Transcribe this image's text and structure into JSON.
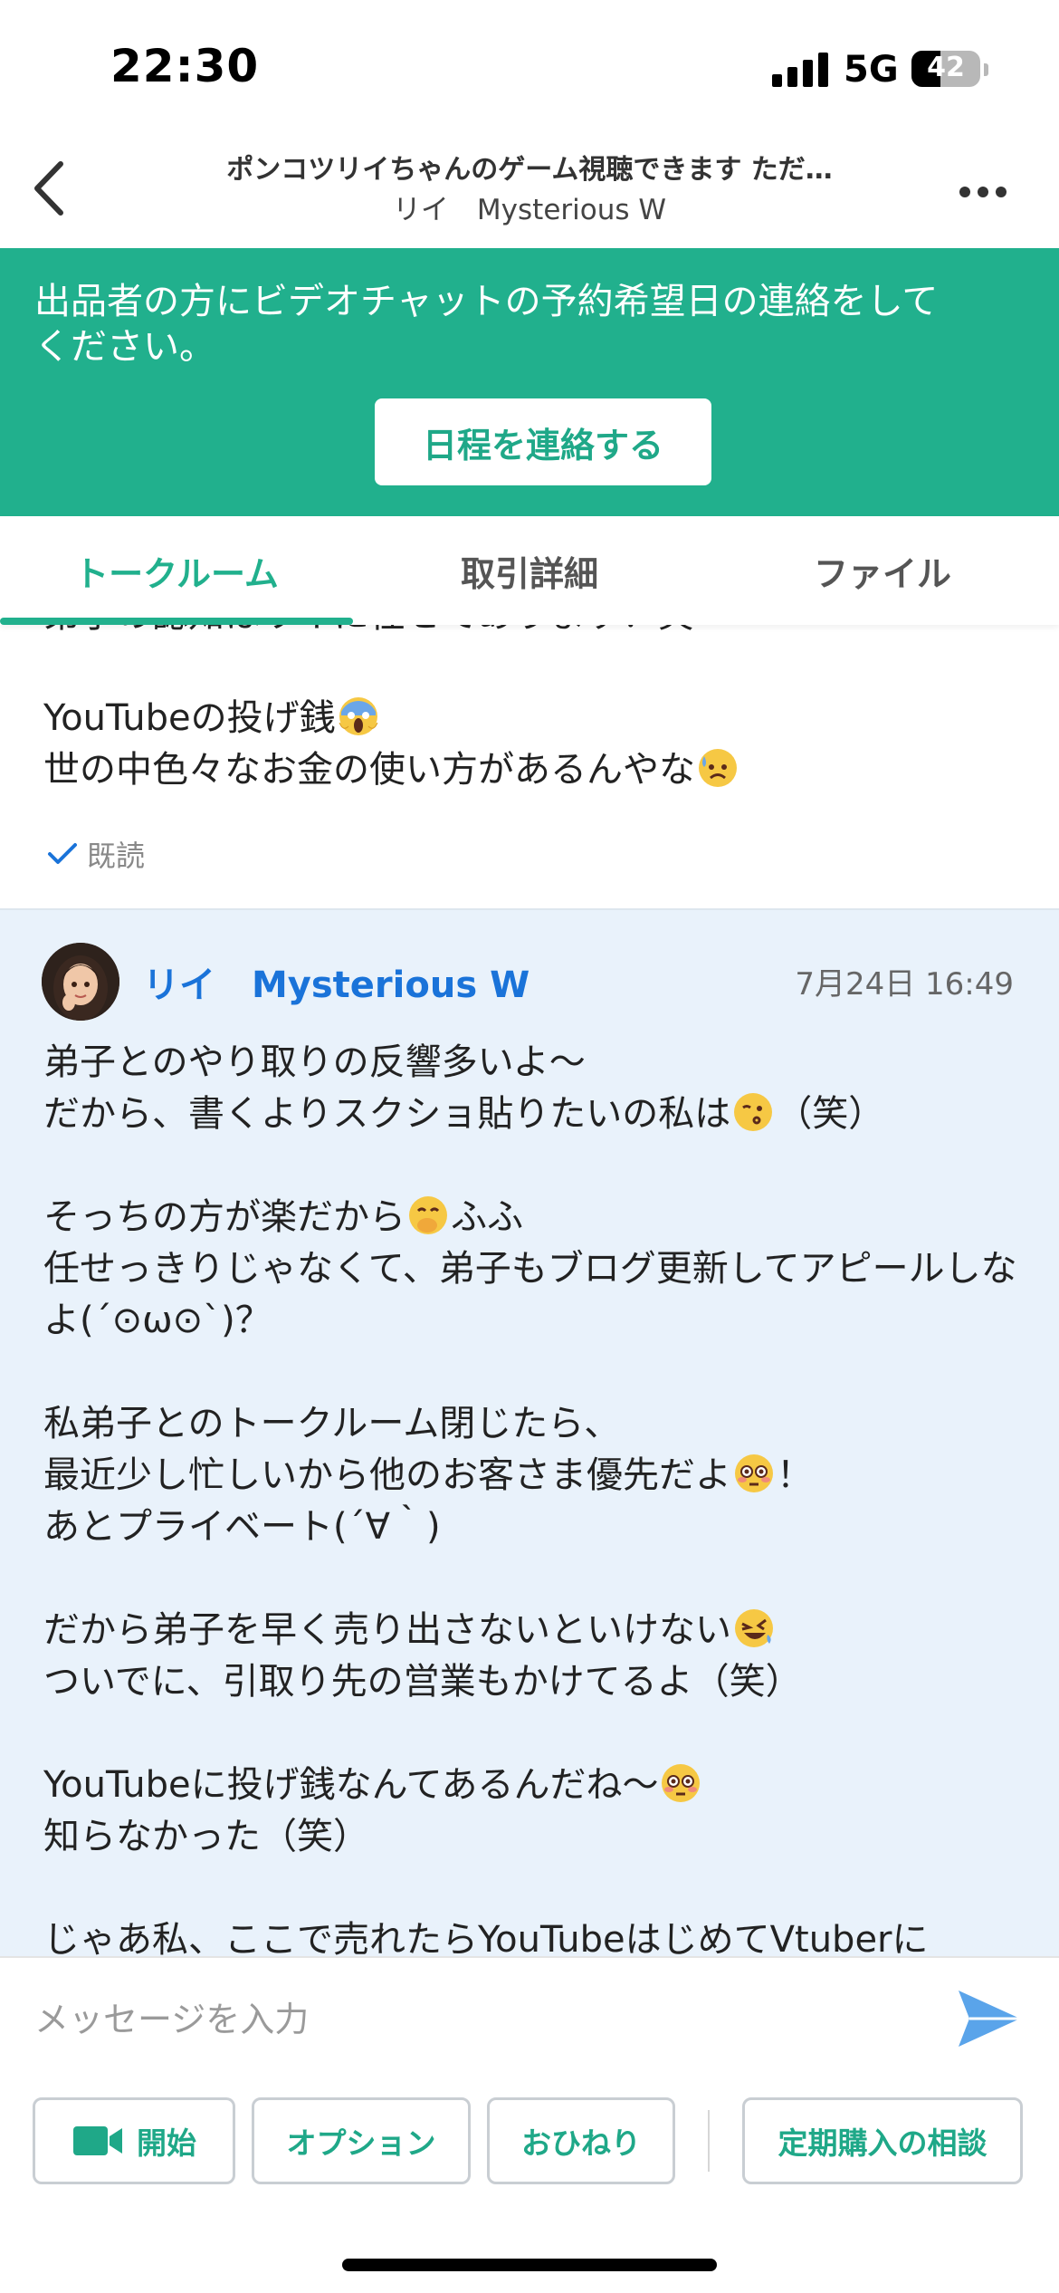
{
  "status_bar": {
    "time": "22:30",
    "network": "5G",
    "battery": "42",
    "battery_level": 0.42
  },
  "header": {
    "title": "ポンコツリイちゃんのゲーム視聴できます ただ…",
    "subtitle": "リイ　Mysterious W"
  },
  "banner": {
    "text": "出品者の方にビデオチャットの予約希望日の連絡をしてください。",
    "button_label": "日程を連絡する"
  },
  "tabs": [
    {
      "label": "トークルーム",
      "active": true
    },
    {
      "label": "取引詳細",
      "active": false
    },
    {
      "label": "ファイル",
      "active": false
    }
  ],
  "messages": {
    "own": {
      "line_clipped": "弟子の認知はリイに任せてあります！笑",
      "line_2": "YouTubeの投げ銭",
      "line_3": "世の中色々なお金の使い方があるんやな",
      "read_label": "既読"
    },
    "other": {
      "sender": "リイ　Mysterious W",
      "time": "7月24日 16:49",
      "l1": "弟子とのやり取りの反響多いよ〜",
      "l2a": "だから、書くよりスクショ貼りたいの私は",
      "l2b": "（笑）",
      "l3a": "そっちの方が楽だから",
      "l3b": "ふふ",
      "l4": "任せっきりじゃなくて、弟子もブログ更新してアピールしなよ(´⊙ω⊙`)？",
      "l5": "私弟子とのトークルーム閉じたら、",
      "l6a": "最近少し忙しいから他のお客さま優先だよ",
      "l6b": "！",
      "l7": "あとプライベート(´∀｀)",
      "l8": "だから弟子を早く売り出さないといけない",
      "l9": "ついでに、引取り先の営業もかけてるよ（笑）",
      "l10": "YouTubeに投げ銭なんてあるんだね〜",
      "l11": "知らなかった（笑）",
      "l12_clipped": "じゃあ私、ここで売れたらYouTubeはじめてVtuberに"
    }
  },
  "composer": {
    "placeholder": "メッセージを入力",
    "buttons": {
      "start": "開始",
      "option": "オプション",
      "tip": "おひねり",
      "subscription": "定期購入の相談"
    }
  },
  "colors": {
    "accent": "#21b08d",
    "link": "#1a73d9",
    "other_bubble_bg": "#e9f2fb",
    "send": "#5aa4ea"
  },
  "icons": [
    "back-chevron-icon",
    "more-dots-icon",
    "check-icon",
    "send-icon",
    "video-camera-icon",
    "signal-icon",
    "battery-icon"
  ]
}
